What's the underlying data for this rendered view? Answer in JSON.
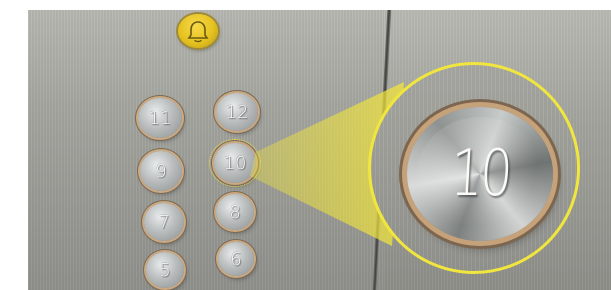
{
  "panel": {
    "bell_icon": "bell-icon",
    "buttons": [
      {
        "label": "11"
      },
      {
        "label": "12"
      },
      {
        "label": "9"
      },
      {
        "label": "10"
      },
      {
        "label": "7"
      },
      {
        "label": "8"
      },
      {
        "label": "5"
      },
      {
        "label": "6"
      }
    ]
  },
  "magnifier": {
    "label": "10"
  },
  "colors": {
    "highlight": "#f1e63d",
    "bell": "#e5c21f",
    "button_rim": "#caa983"
  }
}
